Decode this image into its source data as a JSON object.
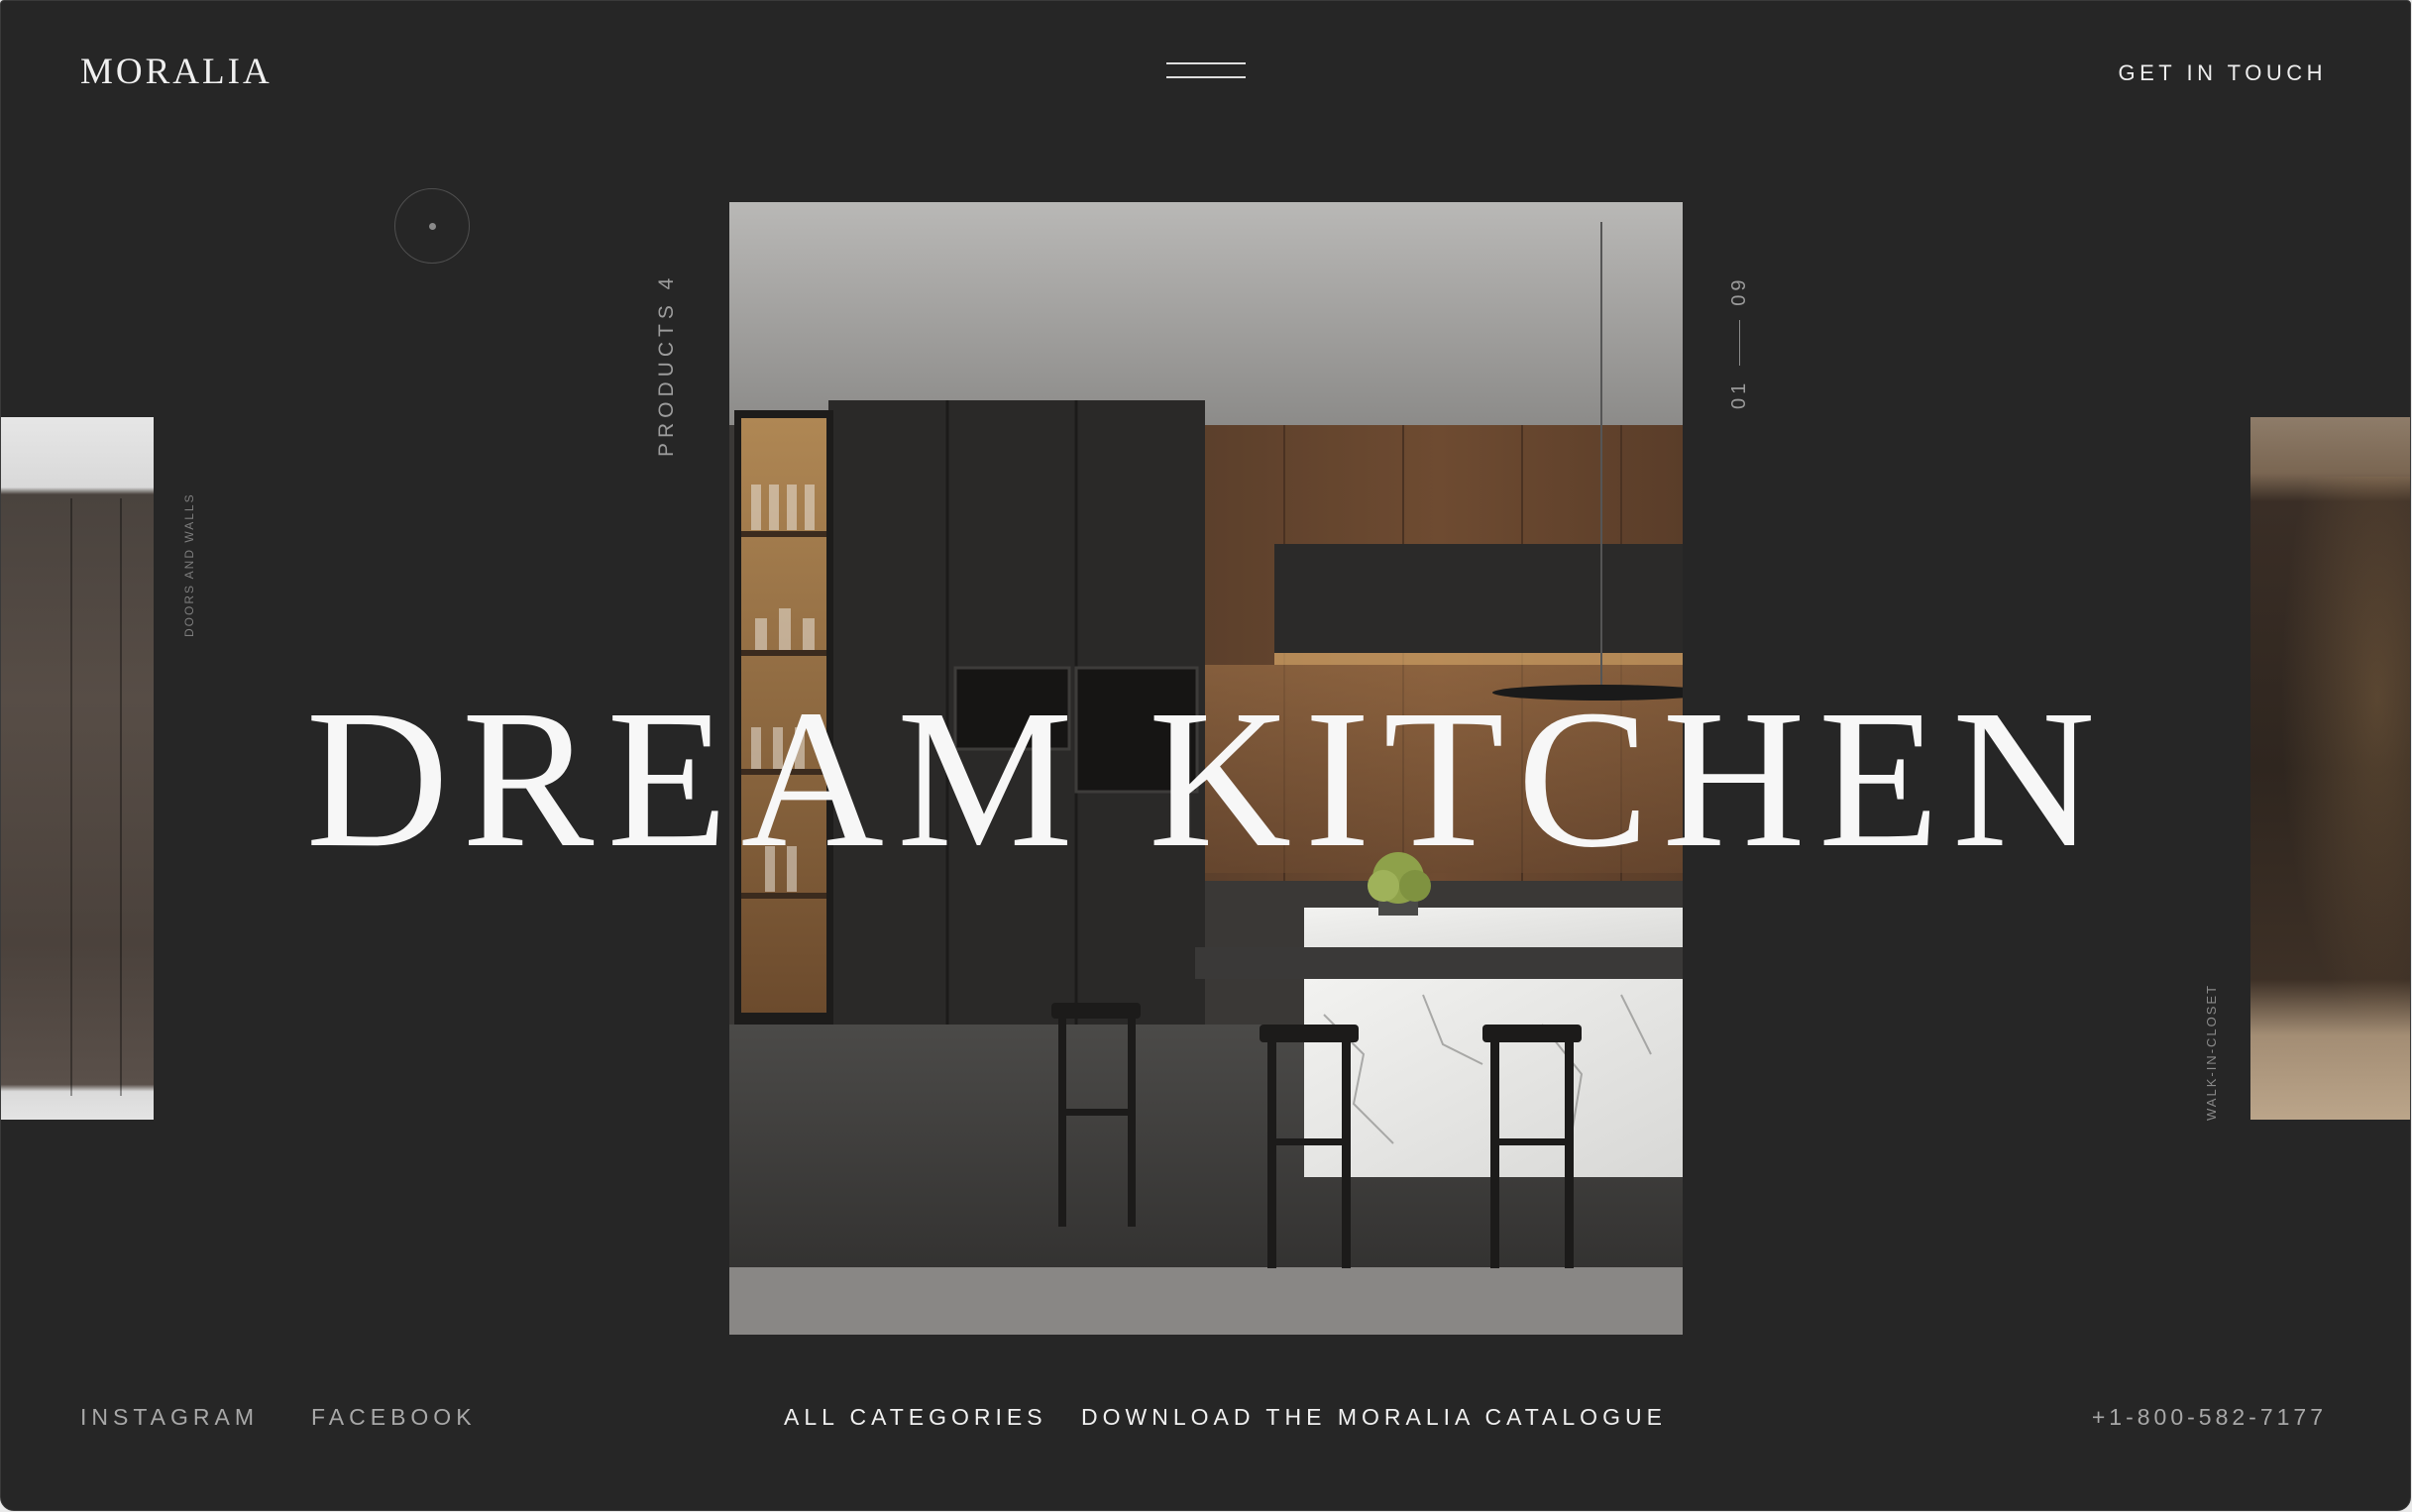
{
  "header": {
    "logo": "MORALIA",
    "menu_icon": "hamburger-menu-icon",
    "cta": "GET IN TOUCH"
  },
  "slider": {
    "products_label": "PRODUCTS 4",
    "current": "01",
    "total": "09",
    "prev_category": "DOORS AND WALLS",
    "next_category": "WALK-IN-CLOSET",
    "title": "DREAM KITCHEN",
    "indicator_icon": "circle-dot-icon"
  },
  "footer": {
    "instagram": "INSTAGRAM",
    "facebook": "FACEBOOK",
    "all_categories": "ALL CATEGORIES",
    "catalogue": "DOWNLOAD THE MORALIA CATALOGUE",
    "phone": "+1-800-582-7177"
  }
}
